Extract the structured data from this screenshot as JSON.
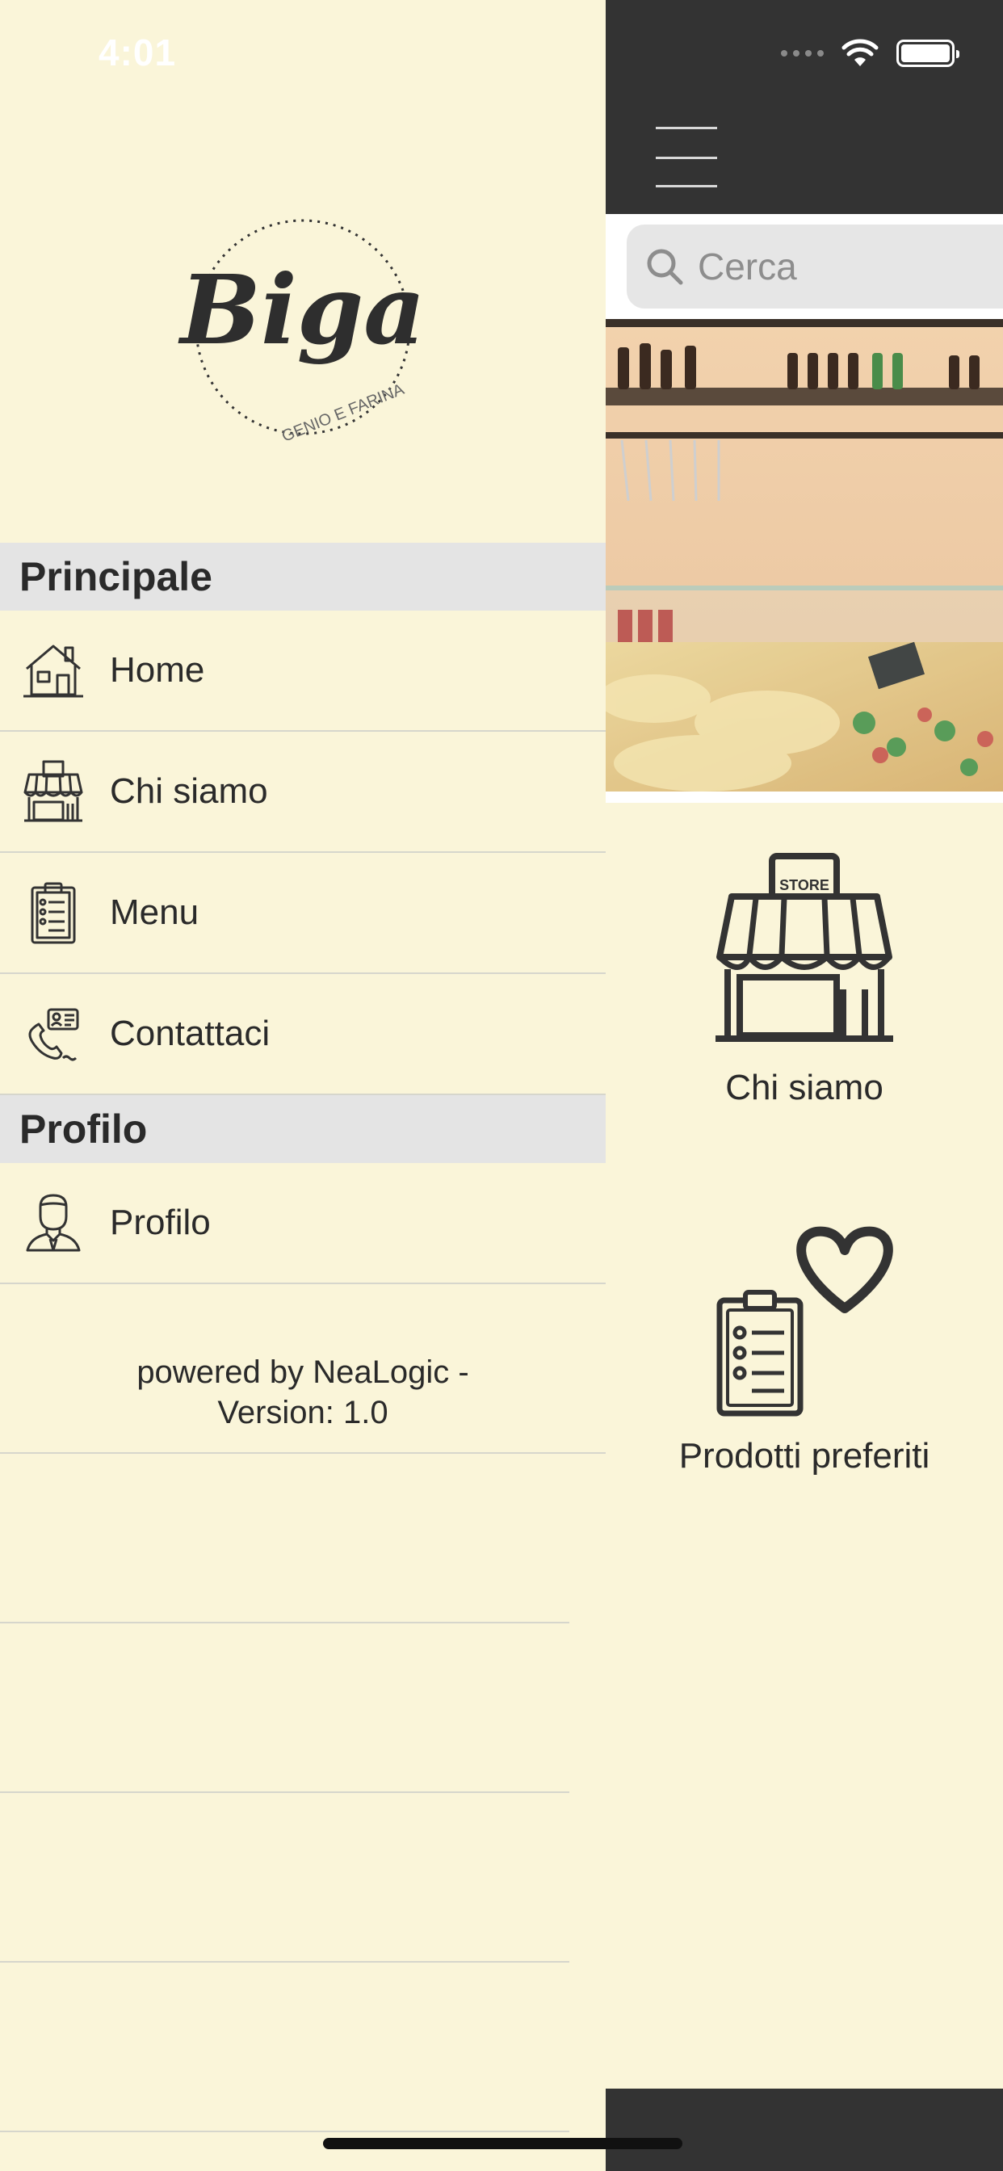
{
  "status_bar": {
    "time": "4:01"
  },
  "main": {
    "search": {
      "placeholder": "Cerca"
    },
    "tiles": [
      {
        "label": "Chi siamo",
        "icon": "store-icon"
      },
      {
        "label": "Prodotti preferiti",
        "icon": "clipboard-heart-icon"
      }
    ],
    "store_sign": "STORE"
  },
  "drawer": {
    "logo": {
      "wordmark": "Biga",
      "tagline": "GENIO E FARINA"
    },
    "sections": [
      {
        "title": "Principale",
        "items": [
          {
            "label": "Home",
            "icon": "house-icon"
          },
          {
            "label": "Chi siamo",
            "icon": "store-icon"
          },
          {
            "label": "Menu",
            "icon": "clipboard-list-icon"
          },
          {
            "label": "Contattaci",
            "icon": "phone-contact-icon"
          }
        ]
      },
      {
        "title": "Profilo",
        "items": [
          {
            "label": "Profilo",
            "icon": "user-icon"
          }
        ]
      }
    ],
    "footer": {
      "line1": "powered by NeaLogic -",
      "line2": "Version: 1.0"
    }
  },
  "colors": {
    "background": "#faf5d9",
    "bar": "#333333",
    "section": "#e4e4e4"
  }
}
